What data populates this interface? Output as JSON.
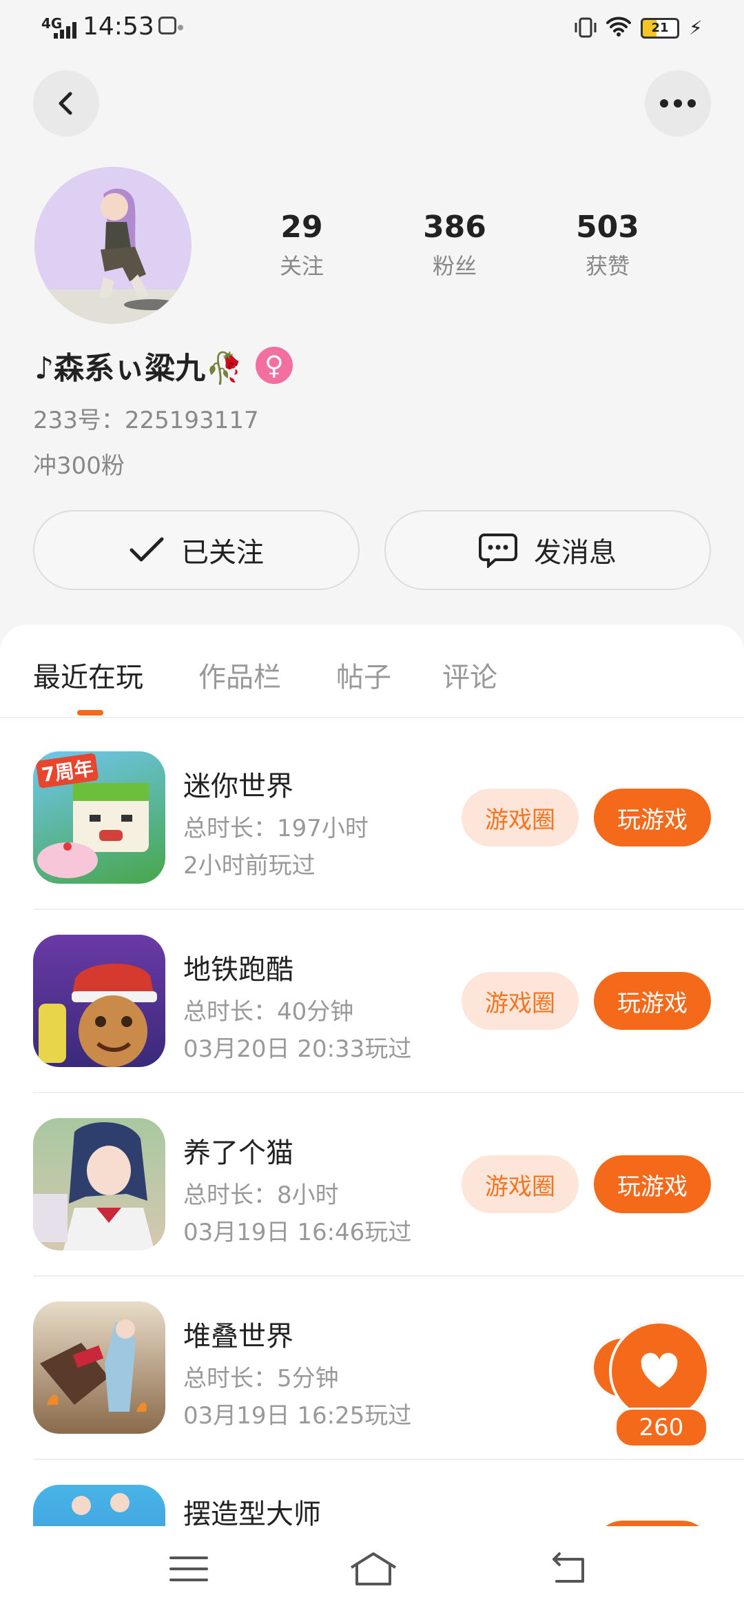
{
  "status_bar": {
    "network": "4G",
    "time": "14:53",
    "battery": "21"
  },
  "profile": {
    "stats": [
      {
        "value": "29",
        "label": "关注"
      },
      {
        "value": "386",
        "label": "粉丝"
      },
      {
        "value": "503",
        "label": "获赞"
      }
    ],
    "nickname": "♪森系ぃ粱九🥀",
    "gender_symbol": "♀",
    "user_id": "233号：225193117",
    "bio": "冲300粉"
  },
  "actions": {
    "follow_label": "已关注",
    "message_label": "发消息"
  },
  "tabs": [
    {
      "label": "最近在玩",
      "active": true
    },
    {
      "label": "作品栏",
      "active": false
    },
    {
      "label": "帖子",
      "active": false
    },
    {
      "label": "评论",
      "active": false
    }
  ],
  "games": [
    {
      "name": "迷你世界",
      "duration": "总时长：197小时",
      "last_played": "2小时前玩过",
      "circle_label": "游戏圈",
      "play_label": "玩游戏",
      "icon_badge": "7周年"
    },
    {
      "name": "地铁跑酷",
      "duration": "总时长：40分钟",
      "last_played": "03月20日 20:33玩过",
      "circle_label": "游戏圈",
      "play_label": "玩游戏"
    },
    {
      "name": "养了个猫",
      "duration": "总时长：8小时",
      "last_played": "03月19日 16:46玩过",
      "circle_label": "游戏圈",
      "play_label": "玩游戏"
    },
    {
      "name": "堆叠世界",
      "duration": "总时长：5分钟",
      "last_played": "03月19日 16:25玩过"
    },
    {
      "name": "摆造型大师"
    }
  ],
  "like": {
    "count": "260"
  },
  "colors": {
    "accent": "#f56a1a",
    "accent_light": "#fde6d9",
    "gender_pink": "#f26fa0"
  }
}
